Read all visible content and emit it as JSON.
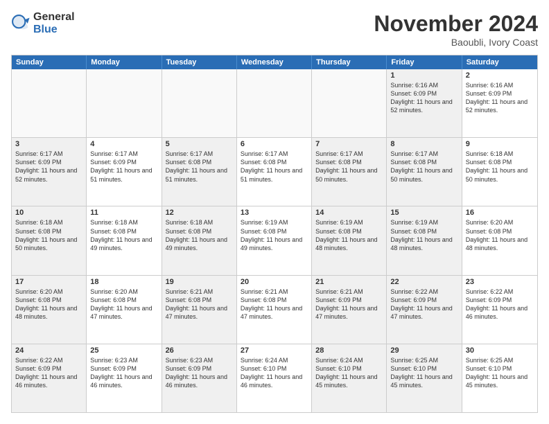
{
  "logo": {
    "general": "General",
    "blue": "Blue"
  },
  "title": "November 2024",
  "location": "Baoubli, Ivory Coast",
  "headers": [
    "Sunday",
    "Monday",
    "Tuesday",
    "Wednesday",
    "Thursday",
    "Friday",
    "Saturday"
  ],
  "rows": [
    [
      {
        "day": "",
        "info": "",
        "empty": true
      },
      {
        "day": "",
        "info": "",
        "empty": true
      },
      {
        "day": "",
        "info": "",
        "empty": true
      },
      {
        "day": "",
        "info": "",
        "empty": true
      },
      {
        "day": "",
        "info": "",
        "empty": true
      },
      {
        "day": "1",
        "info": "Sunrise: 6:16 AM\nSunset: 6:09 PM\nDaylight: 11 hours and 52 minutes.",
        "shaded": true
      },
      {
        "day": "2",
        "info": "Sunrise: 6:16 AM\nSunset: 6:09 PM\nDaylight: 11 hours and 52 minutes.",
        "shaded": false
      }
    ],
    [
      {
        "day": "3",
        "info": "Sunrise: 6:17 AM\nSunset: 6:09 PM\nDaylight: 11 hours and 52 minutes.",
        "shaded": true
      },
      {
        "day": "4",
        "info": "Sunrise: 6:17 AM\nSunset: 6:09 PM\nDaylight: 11 hours and 51 minutes.",
        "shaded": false
      },
      {
        "day": "5",
        "info": "Sunrise: 6:17 AM\nSunset: 6:08 PM\nDaylight: 11 hours and 51 minutes.",
        "shaded": true
      },
      {
        "day": "6",
        "info": "Sunrise: 6:17 AM\nSunset: 6:08 PM\nDaylight: 11 hours and 51 minutes.",
        "shaded": false
      },
      {
        "day": "7",
        "info": "Sunrise: 6:17 AM\nSunset: 6:08 PM\nDaylight: 11 hours and 50 minutes.",
        "shaded": true
      },
      {
        "day": "8",
        "info": "Sunrise: 6:17 AM\nSunset: 6:08 PM\nDaylight: 11 hours and 50 minutes.",
        "shaded": true
      },
      {
        "day": "9",
        "info": "Sunrise: 6:18 AM\nSunset: 6:08 PM\nDaylight: 11 hours and 50 minutes.",
        "shaded": false
      }
    ],
    [
      {
        "day": "10",
        "info": "Sunrise: 6:18 AM\nSunset: 6:08 PM\nDaylight: 11 hours and 50 minutes.",
        "shaded": true
      },
      {
        "day": "11",
        "info": "Sunrise: 6:18 AM\nSunset: 6:08 PM\nDaylight: 11 hours and 49 minutes.",
        "shaded": false
      },
      {
        "day": "12",
        "info": "Sunrise: 6:18 AM\nSunset: 6:08 PM\nDaylight: 11 hours and 49 minutes.",
        "shaded": true
      },
      {
        "day": "13",
        "info": "Sunrise: 6:19 AM\nSunset: 6:08 PM\nDaylight: 11 hours and 49 minutes.",
        "shaded": false
      },
      {
        "day": "14",
        "info": "Sunrise: 6:19 AM\nSunset: 6:08 PM\nDaylight: 11 hours and 48 minutes.",
        "shaded": true
      },
      {
        "day": "15",
        "info": "Sunrise: 6:19 AM\nSunset: 6:08 PM\nDaylight: 11 hours and 48 minutes.",
        "shaded": true
      },
      {
        "day": "16",
        "info": "Sunrise: 6:20 AM\nSunset: 6:08 PM\nDaylight: 11 hours and 48 minutes.",
        "shaded": false
      }
    ],
    [
      {
        "day": "17",
        "info": "Sunrise: 6:20 AM\nSunset: 6:08 PM\nDaylight: 11 hours and 48 minutes.",
        "shaded": true
      },
      {
        "day": "18",
        "info": "Sunrise: 6:20 AM\nSunset: 6:08 PM\nDaylight: 11 hours and 47 minutes.",
        "shaded": false
      },
      {
        "day": "19",
        "info": "Sunrise: 6:21 AM\nSunset: 6:08 PM\nDaylight: 11 hours and 47 minutes.",
        "shaded": true
      },
      {
        "day": "20",
        "info": "Sunrise: 6:21 AM\nSunset: 6:08 PM\nDaylight: 11 hours and 47 minutes.",
        "shaded": false
      },
      {
        "day": "21",
        "info": "Sunrise: 6:21 AM\nSunset: 6:09 PM\nDaylight: 11 hours and 47 minutes.",
        "shaded": true
      },
      {
        "day": "22",
        "info": "Sunrise: 6:22 AM\nSunset: 6:09 PM\nDaylight: 11 hours and 47 minutes.",
        "shaded": true
      },
      {
        "day": "23",
        "info": "Sunrise: 6:22 AM\nSunset: 6:09 PM\nDaylight: 11 hours and 46 minutes.",
        "shaded": false
      }
    ],
    [
      {
        "day": "24",
        "info": "Sunrise: 6:22 AM\nSunset: 6:09 PM\nDaylight: 11 hours and 46 minutes.",
        "shaded": true
      },
      {
        "day": "25",
        "info": "Sunrise: 6:23 AM\nSunset: 6:09 PM\nDaylight: 11 hours and 46 minutes.",
        "shaded": false
      },
      {
        "day": "26",
        "info": "Sunrise: 6:23 AM\nSunset: 6:09 PM\nDaylight: 11 hours and 46 minutes.",
        "shaded": true
      },
      {
        "day": "27",
        "info": "Sunrise: 6:24 AM\nSunset: 6:10 PM\nDaylight: 11 hours and 46 minutes.",
        "shaded": false
      },
      {
        "day": "28",
        "info": "Sunrise: 6:24 AM\nSunset: 6:10 PM\nDaylight: 11 hours and 45 minutes.",
        "shaded": true
      },
      {
        "day": "29",
        "info": "Sunrise: 6:25 AM\nSunset: 6:10 PM\nDaylight: 11 hours and 45 minutes.",
        "shaded": true
      },
      {
        "day": "30",
        "info": "Sunrise: 6:25 AM\nSunset: 6:10 PM\nDaylight: 11 hours and 45 minutes.",
        "shaded": false
      }
    ]
  ]
}
